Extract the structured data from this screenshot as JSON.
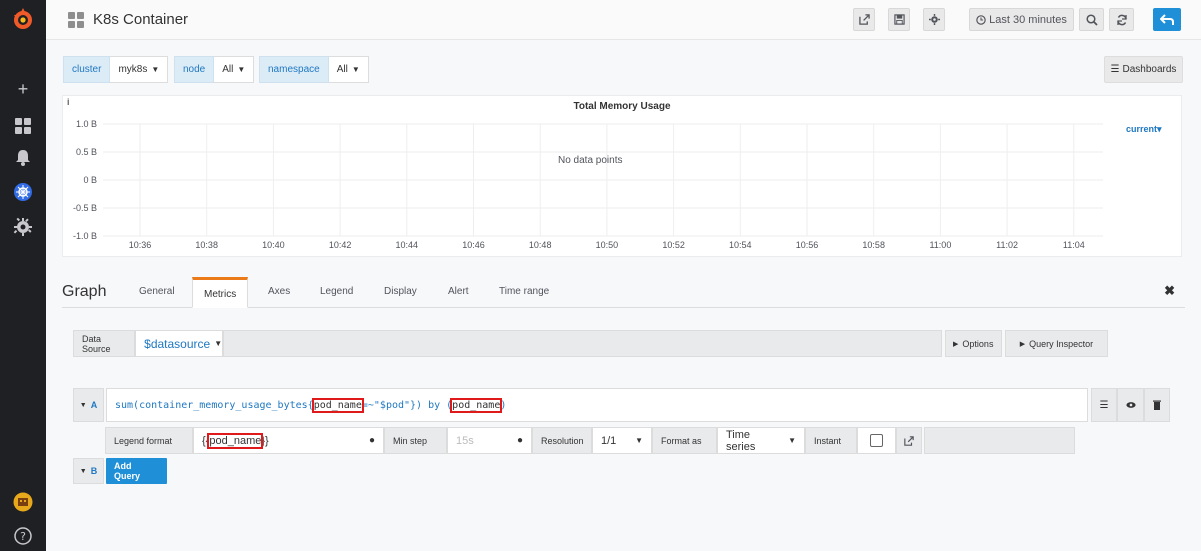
{
  "dashboard": {
    "title": "K8s Container"
  },
  "navbar": {
    "time_range_label": "Last 30 minutes",
    "icons": [
      "share-icon",
      "save-icon",
      "settings-icon",
      "zoom-out-icon",
      "refresh-icon",
      "back-icon"
    ]
  },
  "variables": [
    {
      "label": "cluster",
      "value": "myk8s"
    },
    {
      "label": "node",
      "value": "All"
    },
    {
      "label": "namespace",
      "value": "All"
    }
  ],
  "dashboards_button": "Dashboards",
  "panel": {
    "info": "i",
    "title": "Total Memory Usage",
    "no_data": "No data points",
    "legend_current": "current"
  },
  "chart_data": {
    "type": "line",
    "title": "Total Memory Usage",
    "y_ticks": [
      "1.0 B",
      "0.5 B",
      "0 B",
      "-0.5 B",
      "-1.0 B"
    ],
    "x_ticks": [
      "10:36",
      "10:38",
      "10:40",
      "10:42",
      "10:44",
      "10:46",
      "10:48",
      "10:50",
      "10:52",
      "10:54",
      "10:56",
      "10:58",
      "11:00",
      "11:02",
      "11:04"
    ],
    "ylim": [
      -1.0,
      1.0
    ],
    "series": [],
    "grid": true,
    "legend_placement": "right"
  },
  "editor": {
    "title": "Graph",
    "tabs": [
      "General",
      "Metrics",
      "Axes",
      "Legend",
      "Display",
      "Alert",
      "Time range"
    ],
    "active_tab": "Metrics"
  },
  "data_source": {
    "label": "Data Source",
    "value": "$datasource",
    "options_btn": "Options",
    "query_inspector_btn": "Query Inspector"
  },
  "query_a": {
    "ref": "A",
    "expr_prefix": "sum(container_memory_usage_bytes{",
    "expr_highlight1": "pod_name",
    "expr_middle": "=~\"$pod\"}) by (",
    "expr_highlight2": "pod_name",
    "expr_suffix": ")",
    "legend_format_label": "Legend format",
    "legend_prefix": "{{",
    "legend_highlight": "pod_name",
    "legend_suffix": "}}",
    "min_step_label": "Min step",
    "min_step_placeholder": "15s",
    "resolution_label": "Resolution",
    "resolution_value": "1/1",
    "format_as_label": "Format as",
    "format_as_value": "Time series",
    "instant_label": "Instant"
  },
  "query_b": {
    "ref": "B"
  },
  "add_query_label": "Add Query"
}
